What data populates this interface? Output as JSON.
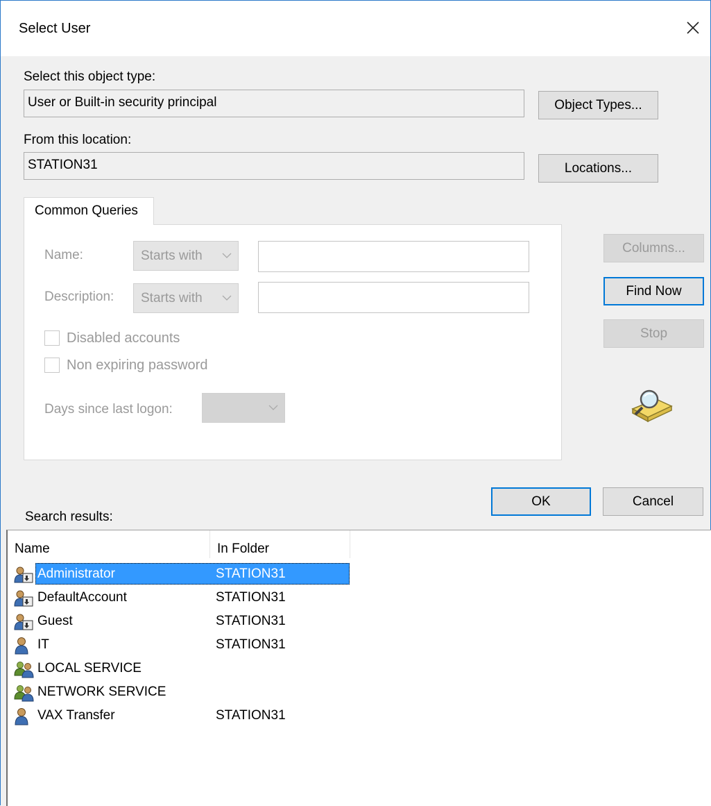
{
  "window": {
    "title": "Select User"
  },
  "object_type": {
    "label": "Select this object type:",
    "value": "User or Built-in security principal",
    "button": "Object Types..."
  },
  "location": {
    "label": "From this location:",
    "value": "STATION31",
    "button": "Locations..."
  },
  "tab": {
    "label": "Common Queries"
  },
  "query": {
    "name_label": "Name:",
    "name_combo": "Starts with",
    "name_value": "",
    "description_label": "Description:",
    "description_combo": "Starts with",
    "description_value": "",
    "disabled_accounts": "Disabled accounts",
    "non_expiring": "Non expiring password",
    "days_label": "Days since last logon:",
    "days_value": ""
  },
  "side_buttons": {
    "columns": "Columns...",
    "find_now": "Find Now",
    "stop": "Stop"
  },
  "dialog_buttons": {
    "ok": "OK",
    "cancel": "Cancel"
  },
  "results": {
    "label": "Search results:",
    "columns": [
      "Name",
      "In Folder"
    ],
    "rows": [
      {
        "name": "Administrator",
        "folder": "STATION31",
        "icon": "user-down-icon",
        "selected": true
      },
      {
        "name": "DefaultAccount",
        "folder": "STATION31",
        "icon": "user-down-icon",
        "selected": false
      },
      {
        "name": "Guest",
        "folder": "STATION31",
        "icon": "user-down-icon",
        "selected": false
      },
      {
        "name": "IT",
        "folder": "STATION31",
        "icon": "user-icon",
        "selected": false
      },
      {
        "name": "LOCAL SERVICE",
        "folder": "",
        "icon": "group-icon",
        "selected": false
      },
      {
        "name": "NETWORK SERVICE",
        "folder": "",
        "icon": "group-icon",
        "selected": false
      },
      {
        "name": "VAX Transfer",
        "folder": "STATION31",
        "icon": "user-icon",
        "selected": false
      }
    ]
  },
  "colors": {
    "selection": "#3399ff",
    "focus_border": "#0078d7",
    "window_border": "#2b79c9"
  }
}
